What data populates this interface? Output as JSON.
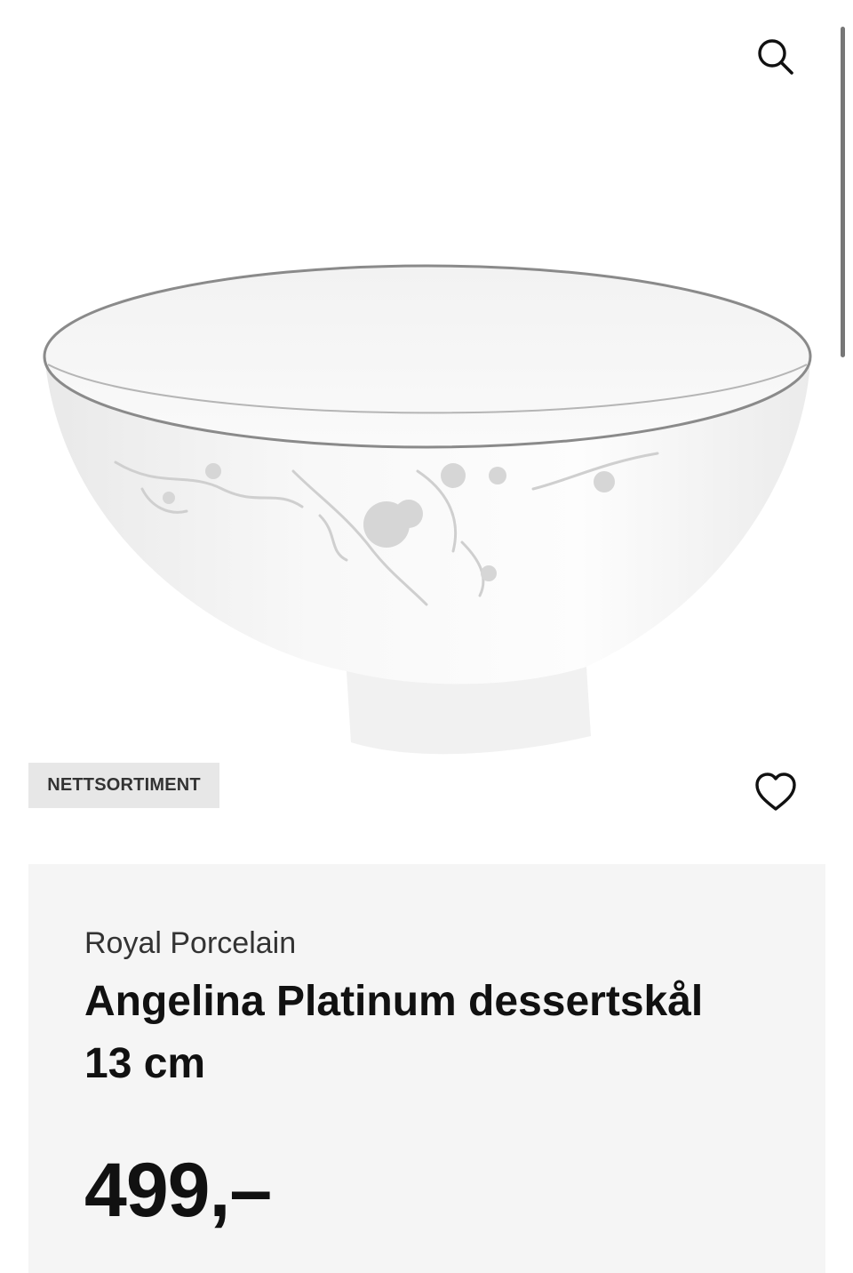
{
  "header": {
    "search_icon": "search-icon"
  },
  "product": {
    "image_alt": "Angelina Platinum dessertskål 13 cm",
    "badge": "NETTSORTIMENT",
    "favorite_icon": "heart-icon",
    "brand": "Royal Porcelain",
    "title": "Angelina Platinum dessertskål 13 cm",
    "price": "499,–"
  },
  "colors": {
    "card_background": "#f5f5f5",
    "badge_background": "#e7e7e7",
    "text": "#111111"
  }
}
